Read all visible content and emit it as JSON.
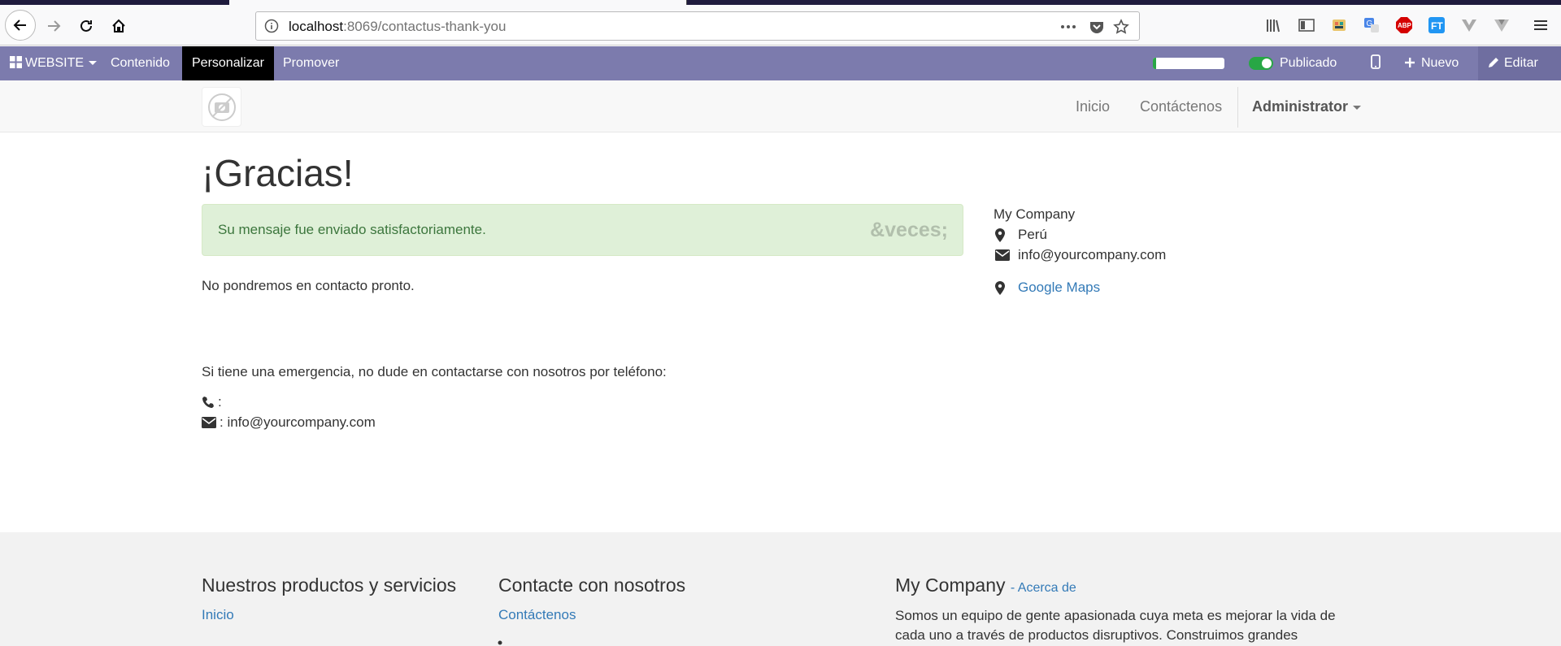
{
  "browser": {
    "url_host": "localhost",
    "url_path": ":8069/contactus-thank-you",
    "page_actions_icon": "more-dots-icon"
  },
  "odoo_bar": {
    "website_label": "WEBSITE",
    "contenido_label": "Contenido",
    "personalizar_label": "Personalizar",
    "promover_label": "Promover",
    "progress_percent": 5,
    "publicado_label": "Publicado",
    "nuevo_label": "Nuevo",
    "editar_label": "Editar"
  },
  "header": {
    "menu": [
      "Inicio",
      "Contáctenos"
    ],
    "user": "Administrator"
  },
  "main": {
    "title": "¡Gracias!",
    "alert_message": "Su mensaje fue enviado satisfactoriamente.",
    "alert_close": "&veces;",
    "contact_soon": "No pondremos en contacto pronto.",
    "emergency": "Si tiene una emergencia, no dude en contactarse con nosotros por teléfono:",
    "phone_line": ":",
    "email_line": ": info@yourcompany.com"
  },
  "sidebar": {
    "company": "My Company",
    "country": "Perú",
    "email": "info@yourcompany.com",
    "maps": "Google Maps"
  },
  "footer": {
    "col1_title": "Nuestros productos y servicios",
    "col1_link": "Inicio",
    "col2_title": "Contacte con nosotros",
    "col2_link": "Contáctenos",
    "col3_title": "My Company",
    "col3_sub": "- Acerca de",
    "col3_text_line1": "Somos un equipo de gente apasionada cuya meta es mejorar la vida de",
    "col3_text_line2": "cada uno a través de productos disruptivos. Construimos grandes"
  },
  "colors": {
    "odoo_bar": "#7c7bad",
    "alert_bg": "#dff0d8",
    "alert_text": "#3c763d",
    "link": "#337ab7",
    "success": "#28a745"
  }
}
